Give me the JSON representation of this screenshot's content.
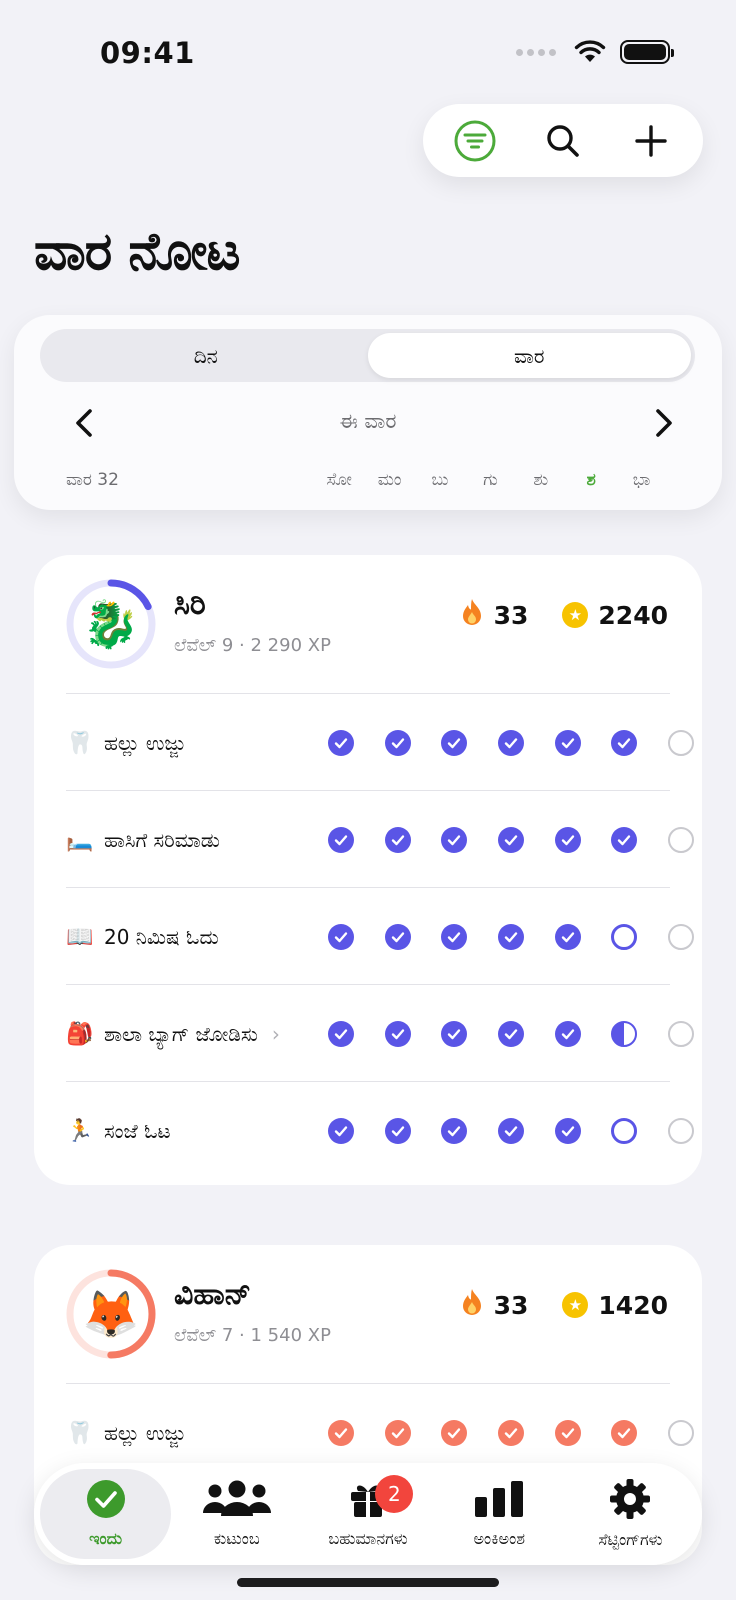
{
  "status": {
    "time": "09:41"
  },
  "title": "ವಾರ ನೋಟ",
  "segments": {
    "day": "ದಿನ",
    "week": "ವಾರ"
  },
  "week": {
    "label": "ಈ ವಾರ",
    "number": "ವಾರ 32",
    "days": [
      "ಸೋ",
      "ಮಂ",
      "ಬು",
      "ಗು",
      "ಶು",
      "ಶ",
      "ಭಾ"
    ],
    "today_index": 5
  },
  "colors": {
    "accent_green": "#4caa3a",
    "purple": "#5a55e6",
    "coral": "#f57a63"
  },
  "children": [
    {
      "name": "ಸಿರಿ",
      "level": "ಲೆವೆಲ್ 9 · 2 290 XP",
      "emoji": "🐉",
      "streak": "33",
      "coins": "2240",
      "ring_color": "#5a55e6",
      "ring_track": "#e6e5fb",
      "ring_progress": 0.18,
      "tasks": [
        {
          "emoji": "🦷",
          "name": "ಹಲ್ಲು ಉಜ್ಜು",
          "status": [
            "done",
            "done",
            "done",
            "done",
            "done",
            "done",
            "empty"
          ]
        },
        {
          "emoji": "🛏️",
          "name": "ಹಾಸಿಗೆ ಸರಿಮಾಡು",
          "status": [
            "done",
            "done",
            "done",
            "done",
            "done",
            "done",
            "empty"
          ]
        },
        {
          "emoji": "📖",
          "name": "20 ನಿಮಿಷ ಓದು",
          "status": [
            "done",
            "done",
            "done",
            "done",
            "done",
            "todo",
            "empty"
          ]
        },
        {
          "emoji": "🎒",
          "name": "ಶಾಲಾ ಬ್ಯಾಗ್ ಜೋಡಿಸು",
          "has_chevron": true,
          "status": [
            "done",
            "done",
            "done",
            "done",
            "done",
            "half",
            "empty"
          ]
        },
        {
          "emoji": "🏃",
          "name": "ಸಂಜೆ ಓಟ",
          "status": [
            "done",
            "done",
            "done",
            "done",
            "done",
            "todo",
            "empty"
          ]
        }
      ]
    },
    {
      "name": "ವಿಹಾನ್",
      "level": "ಲೆವೆಲ್ 7 · 1 540 XP",
      "emoji": "🦊",
      "streak": "33",
      "coins": "1420",
      "ring_color": "#f57a63",
      "ring_track": "#fde3de",
      "ring_progress": 0.5,
      "tasks": [
        {
          "emoji": "🦷",
          "name": "ಹಲ್ಲು ಉಜ್ಜು",
          "status": [
            "done",
            "done",
            "done",
            "done",
            "done",
            "done",
            "empty"
          ]
        }
      ]
    }
  ],
  "tabs": [
    {
      "label": "ಇಂದು",
      "icon": "check-circle-icon",
      "active": true
    },
    {
      "label": "ಕುಟುಂಬ",
      "icon": "people-icon"
    },
    {
      "label": "ಬಹುಮಾನಗಳು",
      "icon": "gift-icon",
      "badge": "2"
    },
    {
      "label": "ಅಂಕಿಅಂಶ",
      "icon": "bar-chart-icon"
    },
    {
      "label": "ಸೆಟ್ಟಿಂಗ್‌ಗಳು",
      "icon": "gear-icon"
    }
  ]
}
